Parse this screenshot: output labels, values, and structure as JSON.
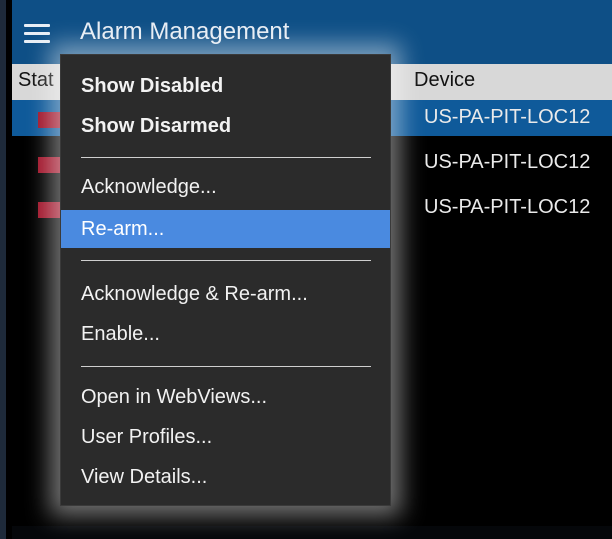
{
  "window": {
    "title": "Alarm Management"
  },
  "table": {
    "columns": {
      "status": "Stat",
      "device": "Device"
    },
    "rows": [
      {
        "device": "US-PA-PIT-LOC12",
        "status_color": "#a0142a",
        "selected": true
      },
      {
        "device": "US-PA-PIT-LOC12",
        "status_color": "#a0142a",
        "selected": false
      },
      {
        "device": "US-PA-PIT-LOC12",
        "status_color": "#a0142a",
        "selected": false
      }
    ]
  },
  "context_menu": {
    "items": {
      "show_disabled": "Show Disabled",
      "show_disarmed": "Show Disarmed",
      "acknowledge": "Acknowledge...",
      "rearm": "Re-arm...",
      "ack_rearm": "Acknowledge & Re-arm...",
      "enable": "Enable...",
      "open_webviews": "Open in WebViews...",
      "user_profiles": "User Profiles...",
      "view_details": "View Details..."
    },
    "highlighted": "Re-arm..."
  },
  "colors": {
    "titlebar": "#0e4f86",
    "menu_bg": "#2b2b2b",
    "highlight": "#4a8ae0",
    "alarm": "#a0142a"
  },
  "icons": {
    "menu": "hamburger-icon"
  }
}
